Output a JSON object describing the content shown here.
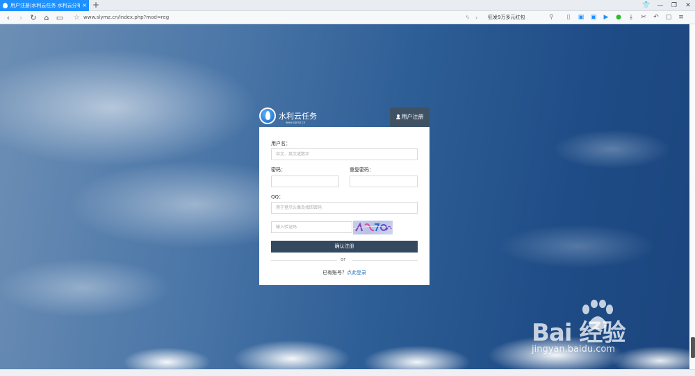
{
  "browser": {
    "tab_title": "用户注册|水利云任务 水利云分布式计",
    "tab_close": "×",
    "new_tab": "+",
    "address": "www.slymz.cn/index.php?mod=reg",
    "promo": "狂发9万多元红包"
  },
  "brand": {
    "name": "水利云任务",
    "sub": "www.slymz.cn"
  },
  "register_tab": {
    "label": "用户注册"
  },
  "form": {
    "username_label": "用户名：",
    "username_placeholder": "中文、英文或数字",
    "password_label": "密码：",
    "repeat_password_label": "重复密码：",
    "qq_label": "QQ：",
    "qq_placeholder": "用于登示头像及找回密码",
    "captcha_placeholder": "输入验证码",
    "submit_label": "确认注册",
    "or_text": "or",
    "login_prompt": "已有账号？",
    "login_link": "点此登录"
  },
  "watermark": {
    "text": "Bai  经验",
    "url": "jingyan.baidu.com"
  },
  "colors": {
    "tab_active": "#1e90ff",
    "register_tab": "#3f5264",
    "submit": "#34495e",
    "link": "#2a78c8"
  }
}
